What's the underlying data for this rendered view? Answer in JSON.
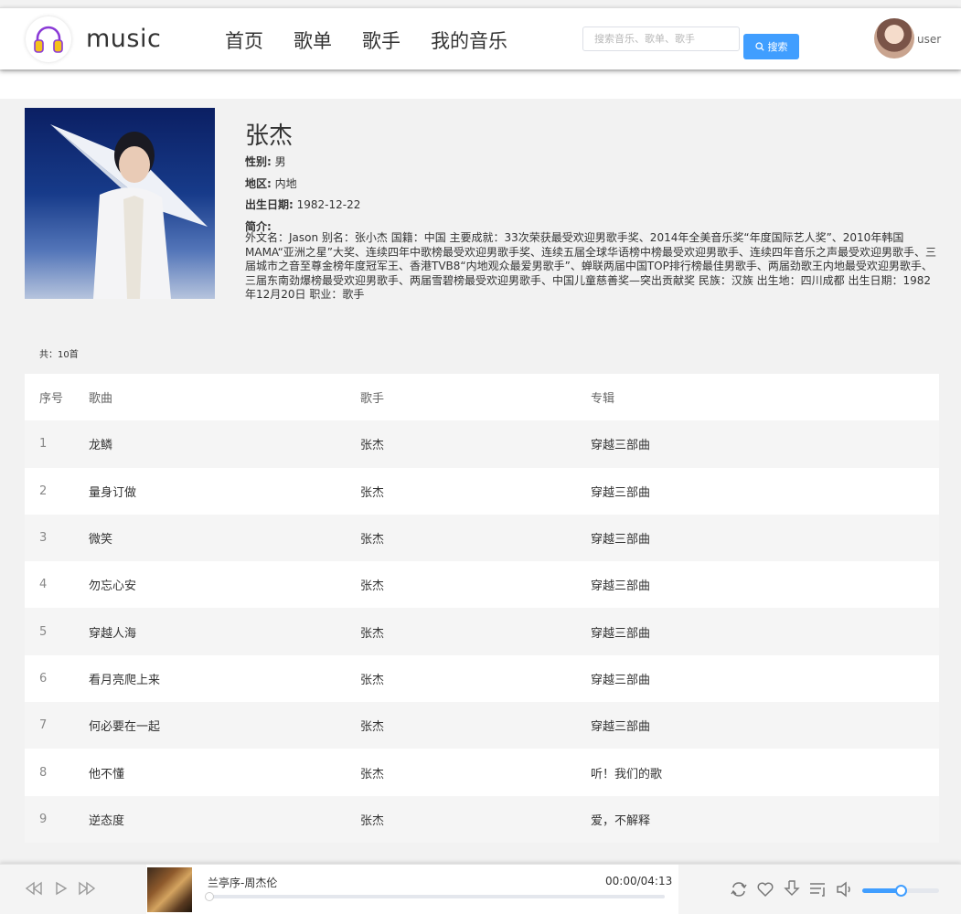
{
  "app": {
    "logo_text": "music"
  },
  "nav": [
    "首页",
    "歌单",
    "歌手",
    "我的音乐"
  ],
  "search": {
    "placeholder": "搜索音乐、歌单、歌手",
    "button_label": "搜索"
  },
  "user": {
    "name": "user"
  },
  "singer": {
    "name": "张杰",
    "gender_label": "性别:",
    "gender": "男",
    "region_label": "地区:",
    "region": "内地",
    "birth_label": "出生日期:",
    "birth": "1982-12-22",
    "intro_label": "简介:",
    "intro": "外文名：Jason 别名：张小杰 国籍：中国 主要成就：33次荣获最受欢迎男歌手奖、2014年全美音乐奖“年度国际艺人奖”、2010年韩国MAMA“亚洲之星”大奖、连续四年中歌榜最受欢迎男歌手奖、连续五届全球华语榜中榜最受欢迎男歌手、连续四年音乐之声最受欢迎男歌手、三届城市之音至尊金榜年度冠军王、香港TVB8“内地观众最爱男歌手”、蝉联两届中国TOP排行榜最佳男歌手、两届劲歌王内地最受欢迎男歌手、三届东南劲爆榜最受欢迎男歌手、两届雪碧榜最受欢迎男歌手、中国儿童慈善奖—突出贡献奖 民族：汉族 出生地：四川成都 出生日期：1982年12月20日 职业：歌手"
  },
  "list": {
    "total": "共：10首",
    "headers": {
      "index": "序号",
      "title": "歌曲",
      "singer": "歌手",
      "album": "专辑"
    },
    "rows": [
      {
        "index": "1",
        "title": "龙鳞",
        "singer": "张杰",
        "album": "穿越三部曲"
      },
      {
        "index": "2",
        "title": "量身订做",
        "singer": "张杰",
        "album": "穿越三部曲"
      },
      {
        "index": "3",
        "title": "微笑",
        "singer": "张杰",
        "album": "穿越三部曲"
      },
      {
        "index": "4",
        "title": "勿忘心安",
        "singer": "张杰",
        "album": "穿越三部曲"
      },
      {
        "index": "5",
        "title": "穿越人海",
        "singer": "张杰",
        "album": "穿越三部曲"
      },
      {
        "index": "6",
        "title": "看月亮爬上来",
        "singer": "张杰",
        "album": "穿越三部曲"
      },
      {
        "index": "7",
        "title": "何必要在一起",
        "singer": "张杰",
        "album": "穿越三部曲"
      },
      {
        "index": "8",
        "title": "他不懂",
        "singer": "张杰",
        "album": "听！我们的歌"
      },
      {
        "index": "9",
        "title": "逆态度",
        "singer": "张杰",
        "album": "爱，不解释"
      }
    ]
  },
  "player": {
    "song": "兰亭序-周杰伦",
    "time": "00:00/04:13",
    "progress": 0,
    "volume": 0.5
  },
  "colors": {
    "accent": "#409eff"
  }
}
